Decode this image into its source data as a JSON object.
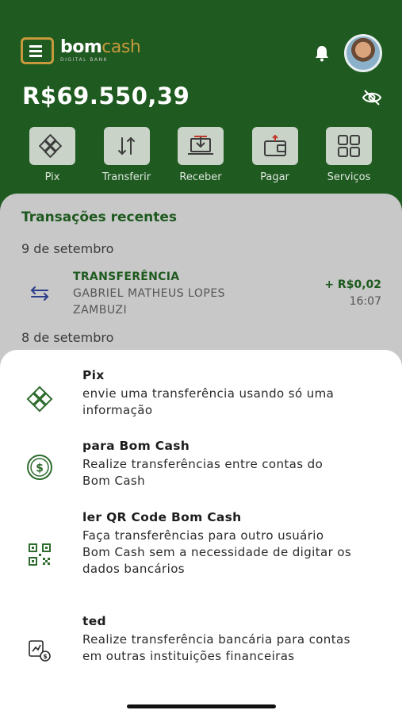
{
  "header": {
    "brand_main": "bom",
    "brand_accent": "cash",
    "brand_sub": "DIGITAL BANK",
    "balance": "R$69.550,39"
  },
  "actions": [
    {
      "label": "Pix",
      "icon": "pix-icon"
    },
    {
      "label": "Transferir",
      "icon": "transfer-arrows-icon"
    },
    {
      "label": "Receber",
      "icon": "receive-laptop-icon"
    },
    {
      "label": "Pagar",
      "icon": "wallet-icon"
    },
    {
      "label": "Serviços",
      "icon": "grid-icon"
    }
  ],
  "recent": {
    "title": "Transações recentes",
    "date_1": "9 de setembro",
    "transaction": {
      "type": "TRANSFERÊNCIA",
      "name": "GABRIEL MATHEUS LOPES ZAMBUZI",
      "amount": "+ R$0,02",
      "time": "16:07"
    },
    "date_2": "8 de setembro"
  },
  "sheet": {
    "options": [
      {
        "title": "Pix",
        "description": "envie uma transferência usando só uma informação",
        "icon": "pix-icon"
      },
      {
        "title": "para Bom Cash",
        "description": "Realize transferências entre contas do Bom Cash",
        "icon": "dollar-coin-icon"
      },
      {
        "title": "ler QR Code Bom Cash",
        "description": "Faça transferências para outro usuário Bom Cash sem a necessidade de digitar os dados bancários",
        "icon": "qr-code-icon"
      },
      {
        "title": "ted",
        "description": "Realize transferência bancária para contas em outras instituições financeiras",
        "icon": "bank-transfer-icon"
      }
    ]
  },
  "colors": {
    "brand_green": "#1f5a20",
    "brand_gold": "#c69a3c",
    "accent_green_text": "#1e5a1f"
  }
}
